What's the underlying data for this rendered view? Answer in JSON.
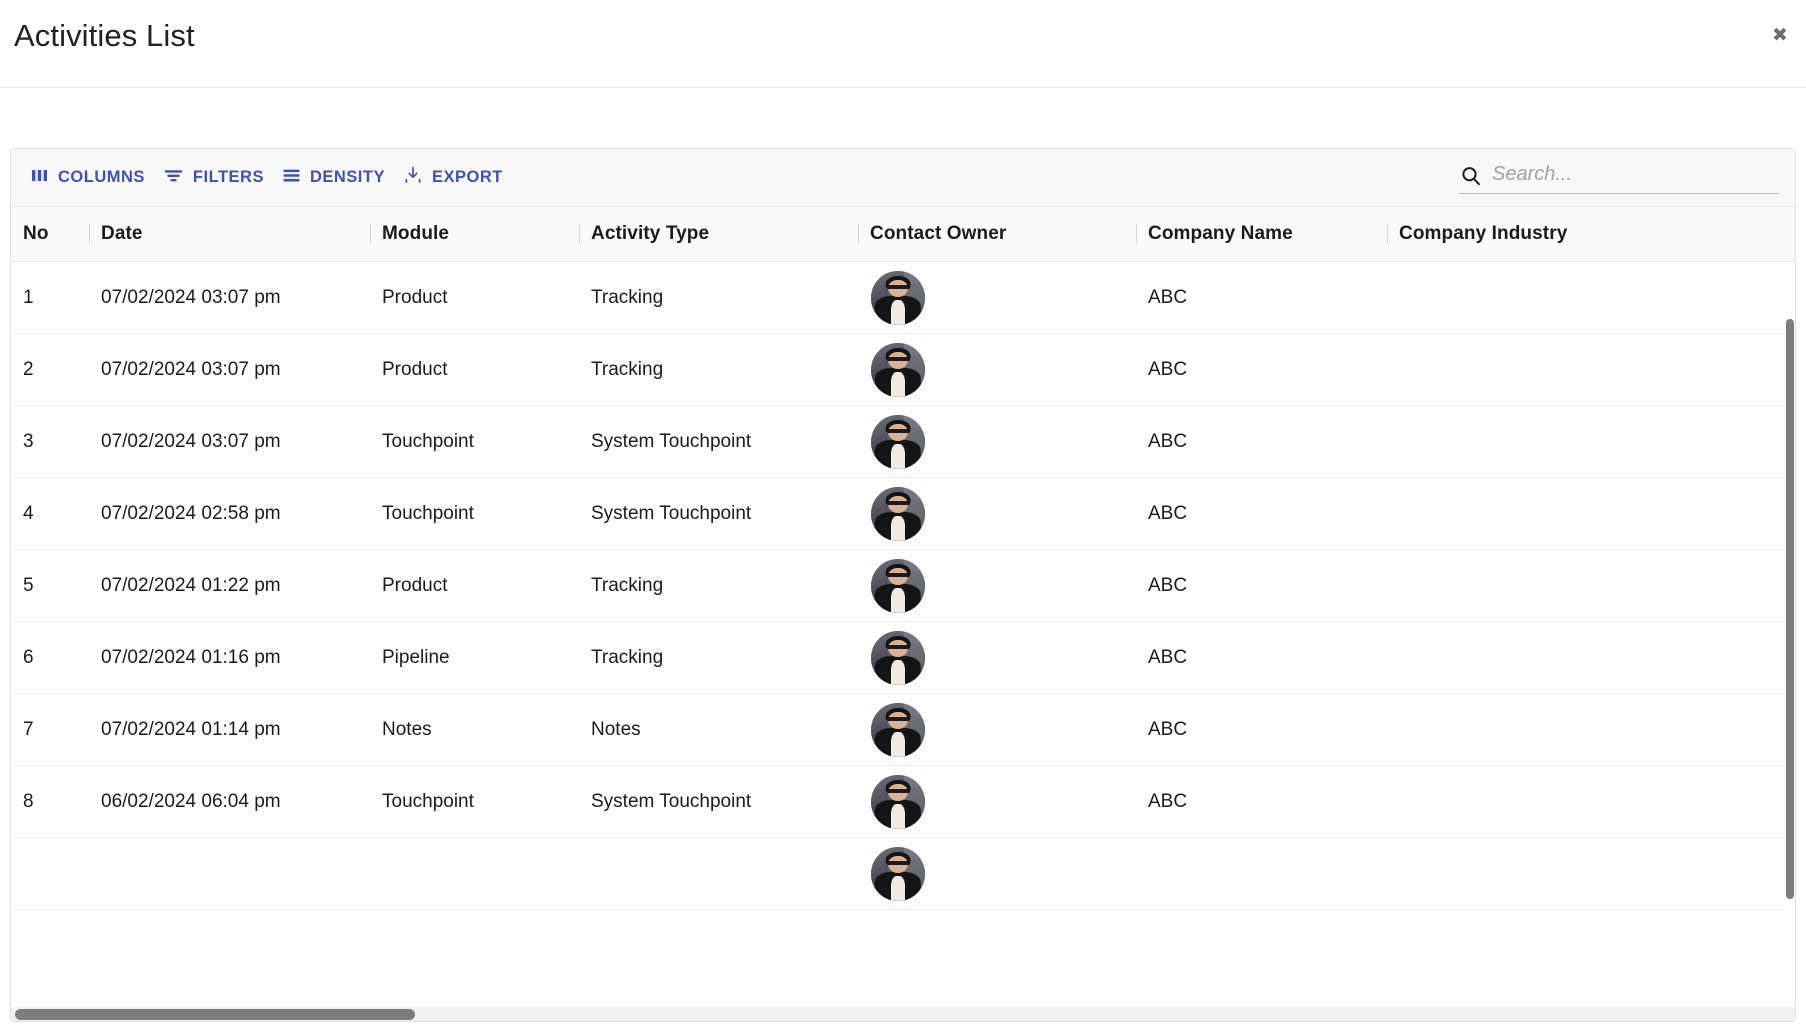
{
  "dialog": {
    "title": "Activities List",
    "close_label": "✖"
  },
  "toolbar": {
    "columns_label": "COLUMNS",
    "filters_label": "FILTERS",
    "density_label": "DENSITY",
    "export_label": "EXPORT",
    "accent_color": "#3f51b5",
    "icons": {
      "columns": "columns-icon",
      "filters": "filter-icon",
      "density": "density-icon",
      "export": "download-icon",
      "search": "search-icon"
    }
  },
  "search": {
    "placeholder": "Search...",
    "value": ""
  },
  "table": {
    "columns": [
      {
        "key": "no",
        "label": "No"
      },
      {
        "key": "date",
        "label": "Date"
      },
      {
        "key": "module",
        "label": "Module"
      },
      {
        "key": "activity_type",
        "label": "Activity Type"
      },
      {
        "key": "contact_owner",
        "label": "Contact Owner"
      },
      {
        "key": "company_name",
        "label": "Company Name"
      },
      {
        "key": "company_industry",
        "label": "Company Industry"
      }
    ],
    "rows": [
      {
        "no": "1",
        "date": "07/02/2024 03:07 pm",
        "module": "Product",
        "activity_type": "Tracking",
        "contact_owner": "avatar",
        "company_name": "ABC",
        "company_industry": ""
      },
      {
        "no": "2",
        "date": "07/02/2024 03:07 pm",
        "module": "Product",
        "activity_type": "Tracking",
        "contact_owner": "avatar",
        "company_name": "ABC",
        "company_industry": ""
      },
      {
        "no": "3",
        "date": "07/02/2024 03:07 pm",
        "module": "Touchpoint",
        "activity_type": "System Touchpoint",
        "contact_owner": "avatar",
        "company_name": "ABC",
        "company_industry": ""
      },
      {
        "no": "4",
        "date": "07/02/2024 02:58 pm",
        "module": "Touchpoint",
        "activity_type": "System Touchpoint",
        "contact_owner": "avatar",
        "company_name": "ABC",
        "company_industry": ""
      },
      {
        "no": "5",
        "date": "07/02/2024 01:22 pm",
        "module": "Product",
        "activity_type": "Tracking",
        "contact_owner": "avatar",
        "company_name": "ABC",
        "company_industry": ""
      },
      {
        "no": "6",
        "date": "07/02/2024 01:16 pm",
        "module": "Pipeline",
        "activity_type": "Tracking",
        "contact_owner": "avatar",
        "company_name": "ABC",
        "company_industry": ""
      },
      {
        "no": "7",
        "date": "07/02/2024 01:14 pm",
        "module": "Notes",
        "activity_type": "Notes",
        "contact_owner": "avatar",
        "company_name": "ABC",
        "company_industry": ""
      },
      {
        "no": "8",
        "date": "06/02/2024 06:04 pm",
        "module": "Touchpoint",
        "activity_type": "System Touchpoint",
        "contact_owner": "avatar",
        "company_name": "ABC",
        "company_industry": ""
      },
      {
        "no": "",
        "date": "",
        "module": "",
        "activity_type": "",
        "contact_owner": "avatar",
        "company_name": "",
        "company_industry": ""
      }
    ]
  }
}
